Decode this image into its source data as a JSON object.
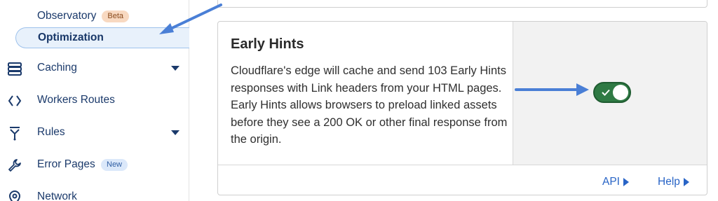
{
  "sidebar": {
    "subitems": [
      {
        "label": "Observatory",
        "badge": "Beta"
      },
      {
        "label": "Optimization"
      }
    ],
    "items": [
      {
        "label": "Caching",
        "icon": "server-stack-icon"
      },
      {
        "label": "Workers Routes",
        "icon": "code-brackets-icon"
      },
      {
        "label": "Rules",
        "icon": "funnel-rules-icon"
      },
      {
        "label": "Error Pages",
        "icon": "wrench-icon",
        "badge": "New"
      },
      {
        "label": "Network",
        "icon": "location-pin-icon"
      }
    ]
  },
  "card": {
    "title": "Early Hints",
    "description": "Cloudflare's edge will cache and send 103 Early Hints responses with Link headers from your HTML pages. Early Hints allows browsers to preload linked assets before they see a 200 OK or other final response from the origin.",
    "toggle_on": true,
    "links": {
      "api": "API",
      "help": "Help"
    }
  },
  "colors": {
    "accent": "#2864c6",
    "toggle_on": "#2f7a44",
    "annotation_arrow": "#4a7fd6",
    "nav_text": "#1b3a6b"
  }
}
